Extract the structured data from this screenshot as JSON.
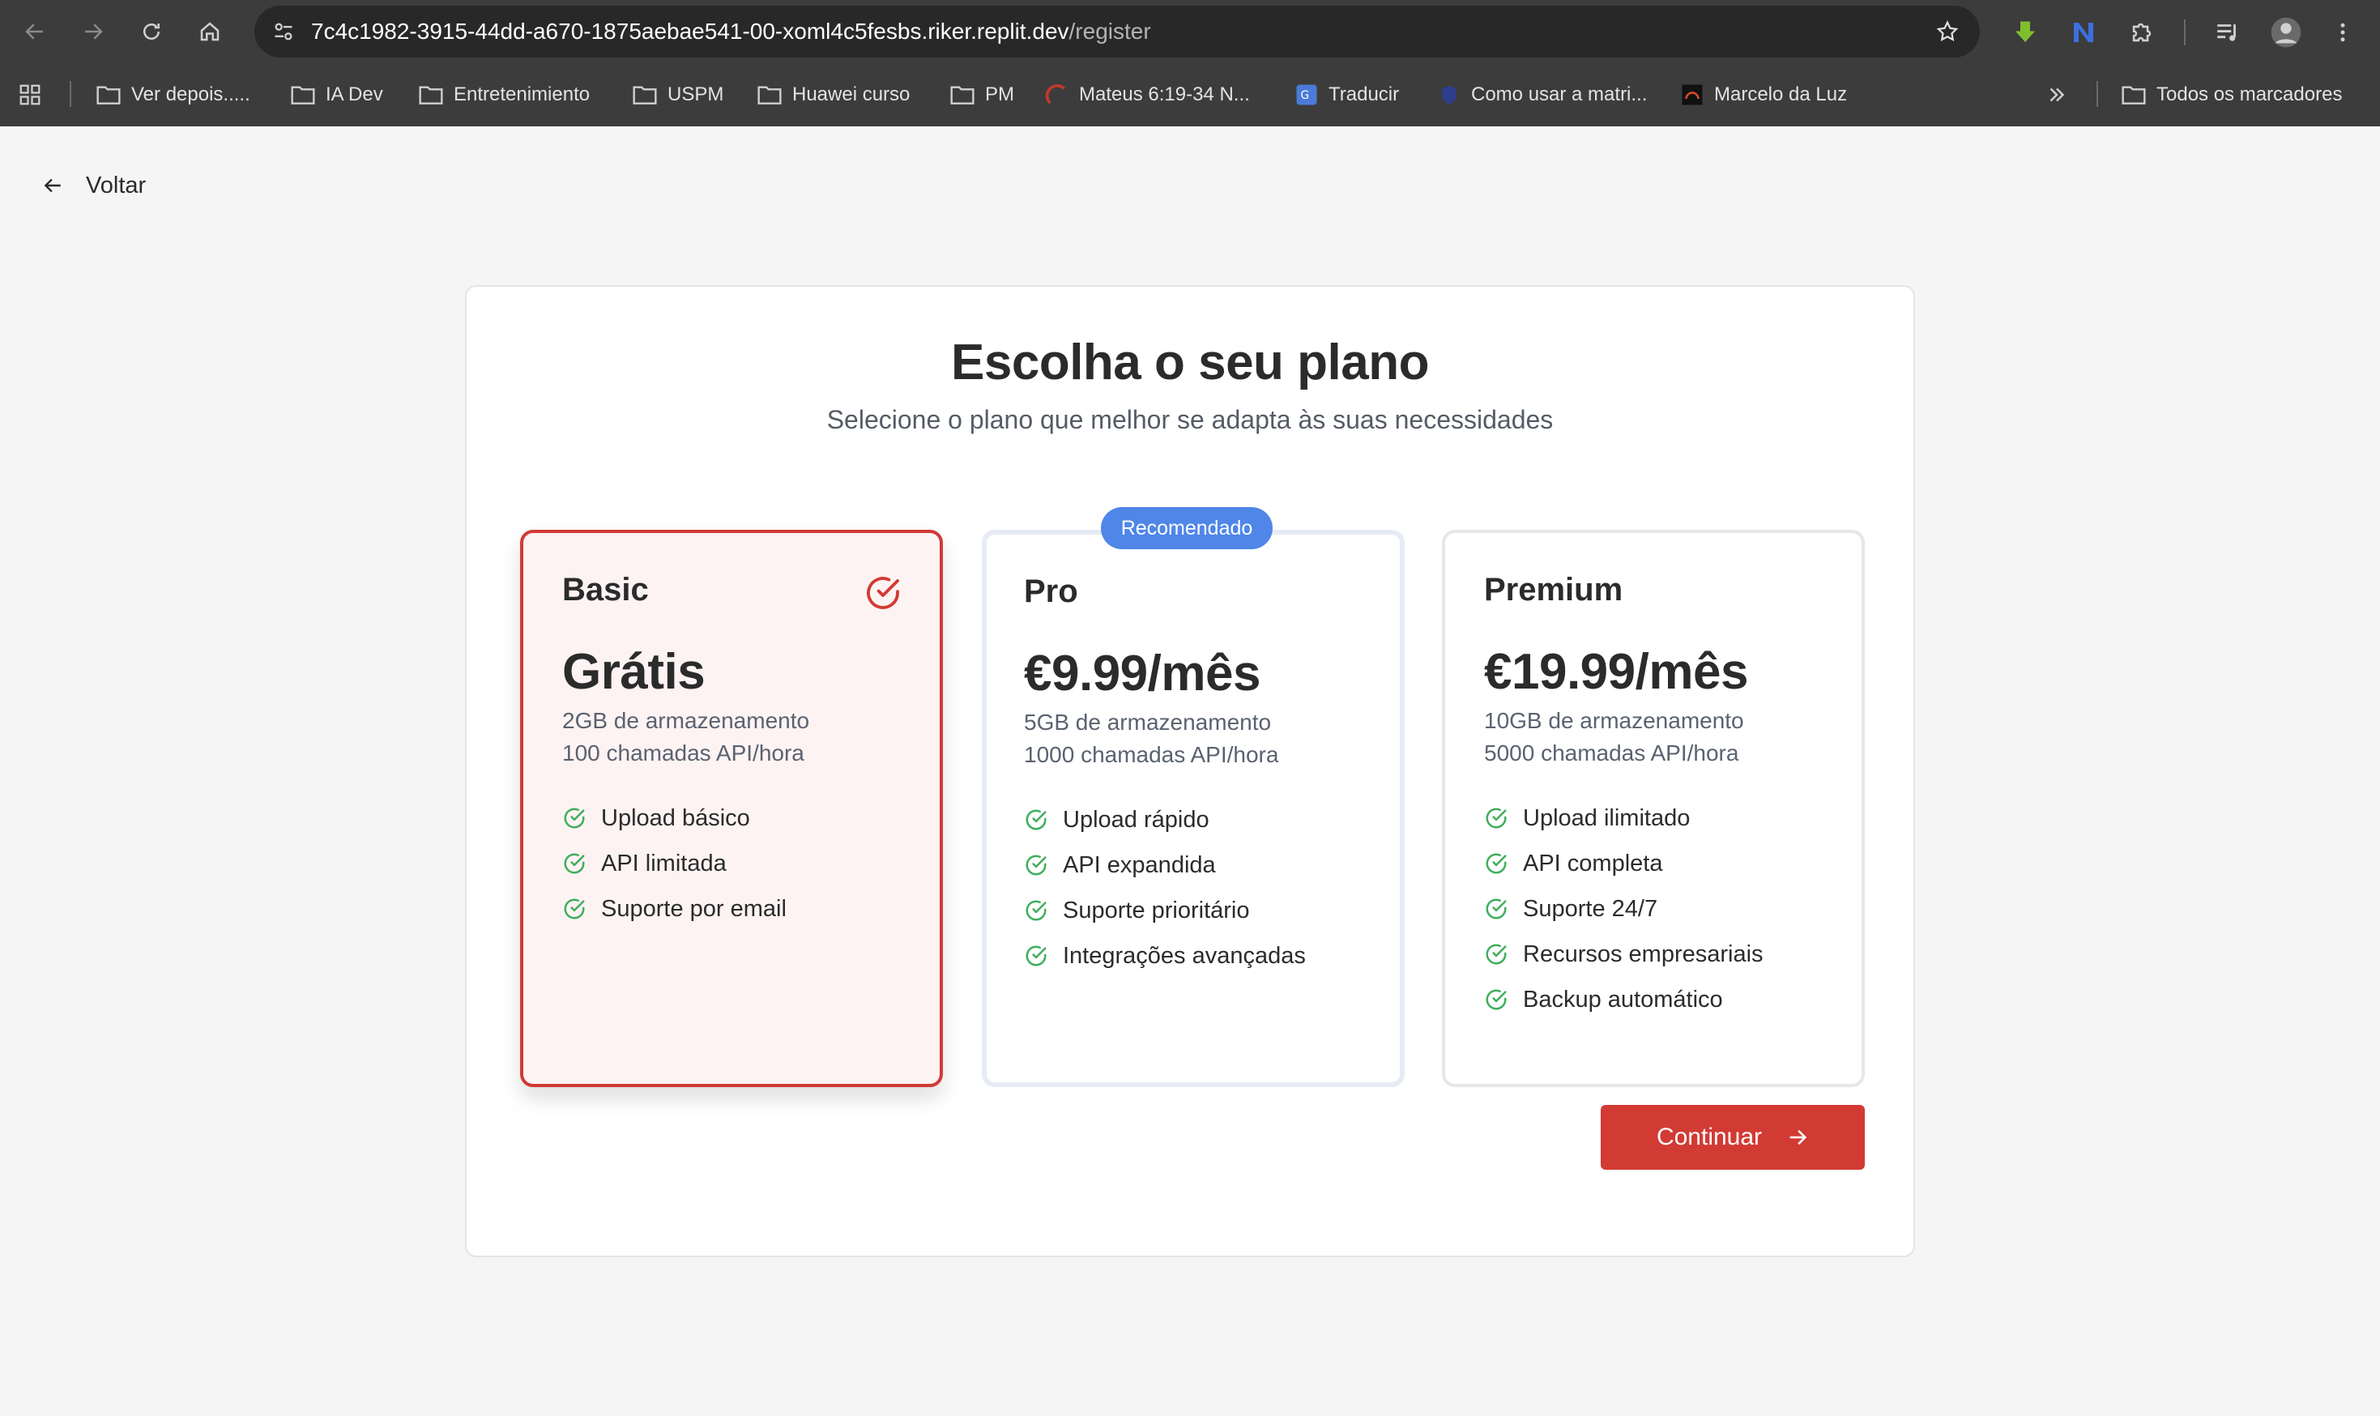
{
  "browser": {
    "url_host": "7c4c1982-3915-44dd-a670-1875aebae541-00-xoml4c5fesbs.riker.replit.dev",
    "url_path": "/register",
    "bookmarks": [
      {
        "label": "Ver depois.....",
        "icon": "folder-icon"
      },
      {
        "label": "IA Dev",
        "icon": "folder-icon"
      },
      {
        "label": "Entretenimiento",
        "icon": "folder-icon"
      },
      {
        "label": "USPM",
        "icon": "folder-icon"
      },
      {
        "label": "Huawei curso",
        "icon": "folder-icon"
      },
      {
        "label": "PM",
        "icon": "folder-icon"
      },
      {
        "label": "Mateus 6:19-34 N...",
        "icon": "site-icon"
      },
      {
        "label": "Traducir",
        "icon": "translate-icon"
      },
      {
        "label": "Como usar a matri...",
        "icon": "site-icon"
      },
      {
        "label": "Marcelo da Luz",
        "icon": "site-icon"
      }
    ],
    "all_bookmarks": "Todos os marcadores"
  },
  "page": {
    "back_label": "Voltar",
    "title": "Escolha o seu plano",
    "subtitle": "Selecione o plano que melhor se adapta às suas necessidades",
    "recommended_badge": "Recomendado",
    "continue_label": "Continuar",
    "plans": [
      {
        "name": "Basic",
        "price": "Grátis",
        "storage": "2GB de armazenamento",
        "api": "100 chamadas API/hora",
        "selected": true,
        "features": [
          "Upload básico",
          "API limitada",
          "Suporte por email"
        ]
      },
      {
        "name": "Pro",
        "price": "€9.99/mês",
        "storage": "5GB de armazenamento",
        "api": "1000 chamadas API/hora",
        "selected": false,
        "features": [
          "Upload rápido",
          "API expandida",
          "Suporte prioritário",
          "Integrações avançadas"
        ]
      },
      {
        "name": "Premium",
        "price": "€19.99/mês",
        "storage": "10GB de armazenamento",
        "api": "5000 chamadas API/hora",
        "selected": false,
        "features": [
          "Upload ilimitado",
          "API completa",
          "Suporte 24/7",
          "Recursos empresariais",
          "Backup automático"
        ]
      }
    ]
  },
  "colors": {
    "accent_red": "#d23a34",
    "selected_bg": "#fdf3f3",
    "badge_blue": "#4f86e8",
    "check_green": "#3fae5c"
  }
}
